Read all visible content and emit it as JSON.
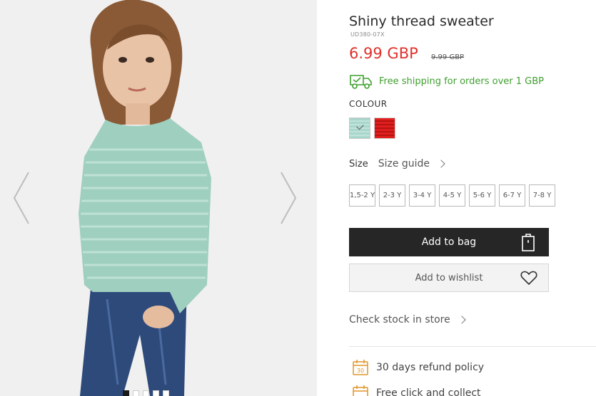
{
  "gallery": {
    "image_alt": "Girl wearing mint shiny thread sweater",
    "dots": 5,
    "active_dot": 0,
    "prev_icon": "chevron-left-icon",
    "next_icon": "chevron-right-icon"
  },
  "product": {
    "title": "Shiny thread sweater",
    "code": "UD380-07X",
    "price": "6.99 GBP",
    "old_price": "9.99 GBP",
    "price_color": "#e0312b"
  },
  "shipping": {
    "icon": "delivery-truck-icon",
    "text": "Free shipping for orders over 1 GBP",
    "color": "#3f9f2f"
  },
  "colour": {
    "label": "COLOUR",
    "options": [
      {
        "name": "mint",
        "selected": true
      },
      {
        "name": "red",
        "selected": false
      }
    ]
  },
  "size": {
    "label": "Size",
    "guide_label": "Size guide",
    "options": [
      "1,5-2 Y",
      "2-3 Y",
      "3-4 Y",
      "4-5 Y",
      "5-6 Y",
      "6-7 Y",
      "7-8 Y"
    ]
  },
  "actions": {
    "add_to_bag": "Add to bag",
    "add_to_wishlist": "Add to wishlist",
    "check_stock": "Check stock in store"
  },
  "perks": [
    {
      "icon": "calendar-30-icon",
      "text": "30 days refund policy"
    },
    {
      "icon": "calendar-icon",
      "text": "Free click and collect"
    }
  ]
}
